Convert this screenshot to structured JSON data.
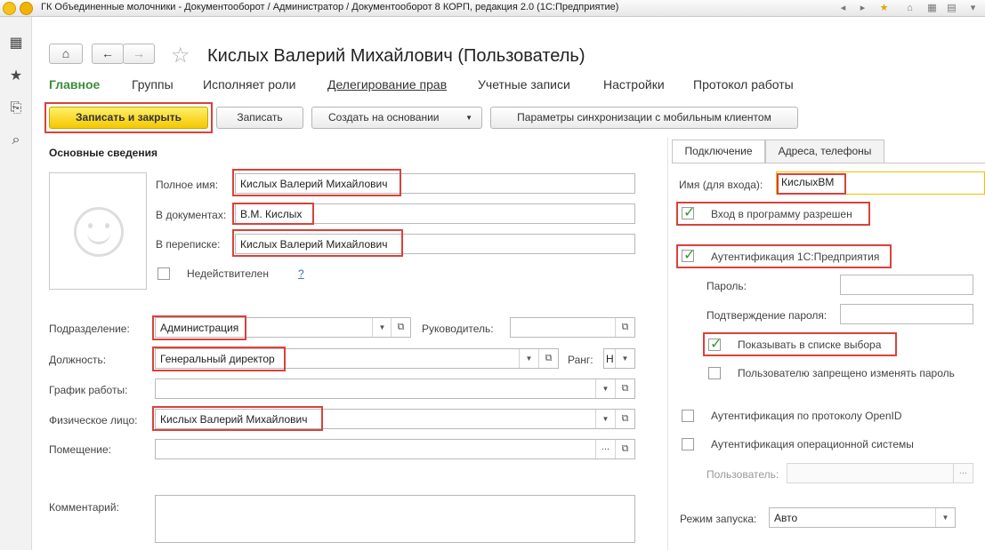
{
  "window": {
    "title": "ГК Объединенные молочники - Документооборот / Администратор / Документооборот 8 КОРП, редакция 2.0  (1С:Предприятие)"
  },
  "header": {
    "title": "Кислых Валерий Михайлович (Пользователь)"
  },
  "tabs": [
    {
      "label": "Главное"
    },
    {
      "label": "Группы"
    },
    {
      "label": "Исполняет роли"
    },
    {
      "label": "Делегирование прав"
    },
    {
      "label": "Учетные записи"
    },
    {
      "label": "Настройки"
    },
    {
      "label": "Протокол работы"
    }
  ],
  "toolbar": {
    "save_close": "Записать и закрыть",
    "save": "Записать",
    "create_based": "Создать на основании",
    "sync_params": "Параметры синхронизации с мобильным клиентом"
  },
  "main": {
    "section_title": "Основные сведения",
    "full_name_label": "Полное имя:",
    "full_name": "Кислых Валерий Михайлович",
    "in_docs_label": "В документах:",
    "in_docs": "В.М. Кислых",
    "in_corr_label": "В переписке:",
    "in_corr": "Кислых Валерий Михайлович",
    "invalid_label": "Недействителен",
    "help_mark": "?",
    "department_label": "Подразделение:",
    "department": "Администрация",
    "manager_label": "Руководитель:",
    "manager": "",
    "position_label": "Должность:",
    "position": "Генеральный директор",
    "rank_label": "Ранг:",
    "rank": "Н",
    "schedule_label": "График работы:",
    "schedule": "",
    "person_label": "Физическое лицо:",
    "person": "Кислых Валерий Михайлович",
    "room_label": "Помещение:",
    "room": "",
    "room_btn": "...",
    "comment_label": "Комментарий:"
  },
  "right": {
    "tab_connection": "Подключение",
    "tab_addresses": "Адреса, телефоны",
    "login_label": "Имя (для входа):",
    "login": "КислыхВМ",
    "login_allowed": "Вход в программу разрешен",
    "auth_1c": "Аутентификация 1С:Предприятия",
    "password_label": "Пароль:",
    "password_confirm_label": "Подтверждение пароля:",
    "show_in_list": "Показывать в списке выбора",
    "no_change_password": "Пользователю запрещено изменять пароль",
    "auth_openid": "Аутентификация по протоколу OpenID",
    "auth_os": "Аутентификация операционной системы",
    "os_user_label": "Пользователь:",
    "os_user_btn": "...",
    "launch_mode_label": "Режим запуска:",
    "launch_mode": "Авто"
  },
  "colors": {
    "accent_green": "#3a8f3a",
    "primary_button": "#f5c800",
    "highlight_red": "#d9423a"
  }
}
